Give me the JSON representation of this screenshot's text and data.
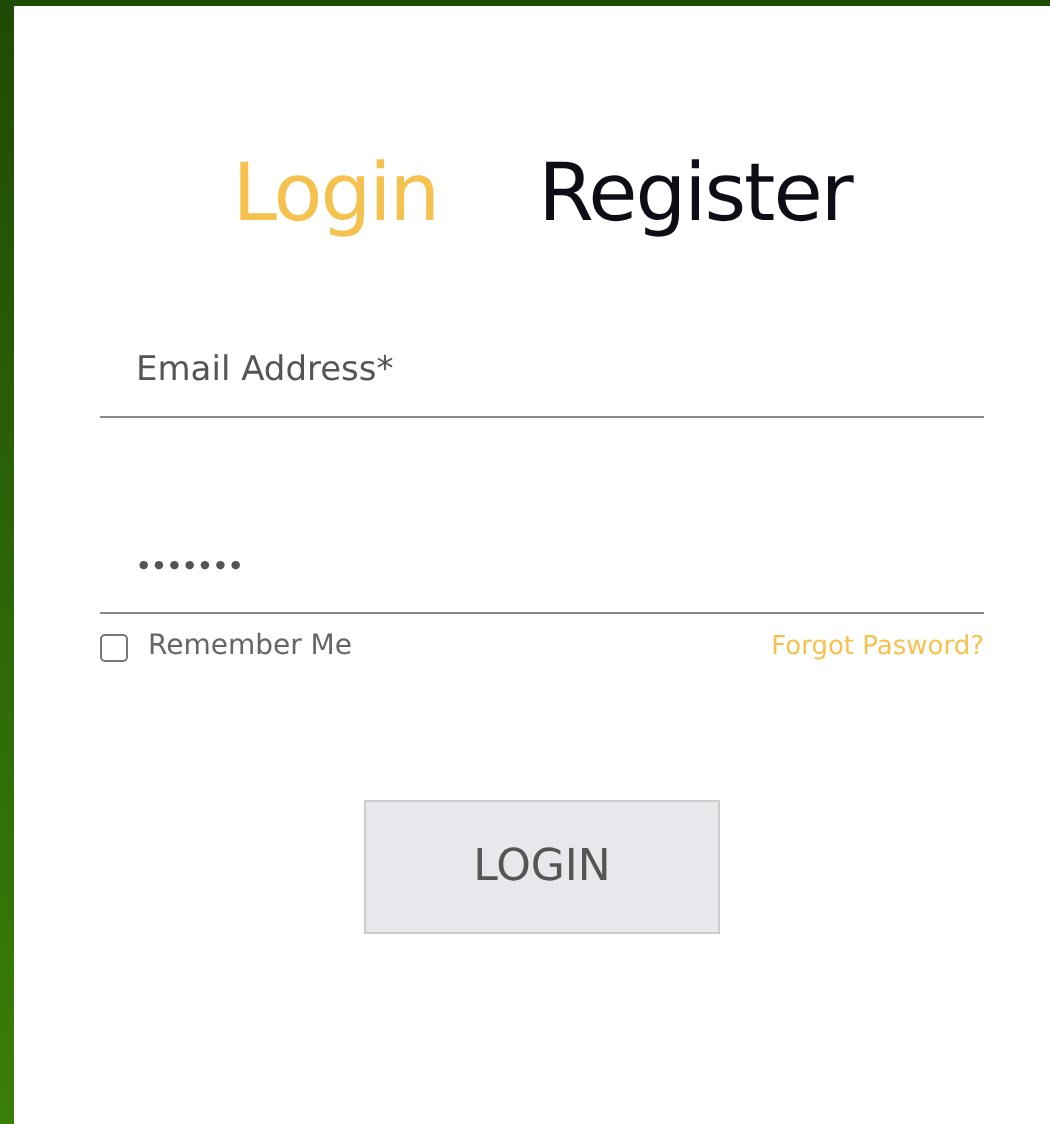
{
  "tabs": [
    {
      "label": "Login",
      "selected": true
    },
    {
      "label": "Register",
      "selected": false
    }
  ],
  "email": {
    "placeholder": "Email Address*"
  },
  "password": {
    "value": "•••••••"
  },
  "remember": {
    "label": "Remember Me",
    "checked": false
  },
  "forgot": "Forgot Pasword?",
  "submit": "LOGIN"
}
